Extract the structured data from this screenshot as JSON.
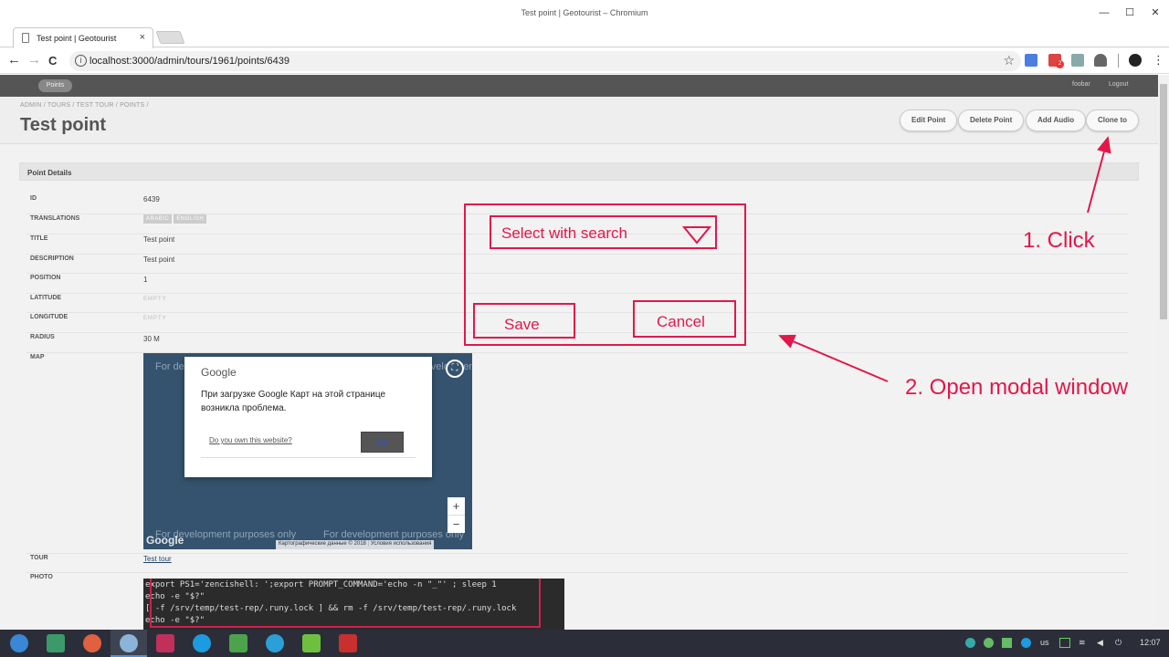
{
  "window": {
    "title": "Test point | Geotourist – Chromium",
    "minimize": "—",
    "maximize": "☐",
    "close": "✕"
  },
  "tabs": [
    {
      "label": "Test point | Geotourist",
      "close": "×"
    }
  ],
  "toolbar": {
    "back": "←",
    "forward": "→",
    "reload": "C",
    "url": "localhost:3000/admin/tours/1961/points/6439",
    "bookmark": "☆",
    "mail_badge": "2"
  },
  "appbar": {
    "nav_pill": "Points",
    "user": "foobar",
    "logout": "Logout"
  },
  "header": {
    "breadcrumbs": "ADMIN  /  TOURS  /  TEST TOUR  /  POINTS  /",
    "title": "Test point",
    "buttons": {
      "edit": "Edit Point",
      "delete": "Delete Point",
      "audio": "Add Audio",
      "clone": "Clone to"
    }
  },
  "panel": {
    "title": "Point Details",
    "rows": {
      "id": {
        "label": "ID",
        "value": "6439"
      },
      "translations": {
        "label": "TRANSLATIONS",
        "badges": [
          "ARABIC",
          "ENGLISH"
        ]
      },
      "title": {
        "label": "TITLE",
        "value": "Test point"
      },
      "description": {
        "label": "DESCRIPTION",
        "value": "Test point"
      },
      "position": {
        "label": "POSITION",
        "value": "1"
      },
      "latitude": {
        "label": "LATITUDE",
        "value": "EMPTY"
      },
      "longitude": {
        "label": "LONGITUDE",
        "value": "EMPTY"
      },
      "radius": {
        "label": "RADIUS",
        "value": "30 M"
      },
      "map": {
        "label": "MAP"
      },
      "tour": {
        "label": "TOUR",
        "value": "Test tour"
      },
      "photo": {
        "label": "PHOTO"
      }
    }
  },
  "map": {
    "watermark": "For development purposes only",
    "watermark_short": "For de",
    "dialog_logo": "Google",
    "dialog_message": "При загрузке Google Карт на этой странице возникла проблема.",
    "dialog_own": "Do you own this website?",
    "dialog_ok": "OK",
    "zoom_in": "+",
    "zoom_out": "−",
    "fullscreen": "⛶",
    "google": "Google",
    "attribution": "Картографические данные © 2018",
    "terms": "Условия использования"
  },
  "terminal": {
    "lines": [
      "export PS1='zencishell: ';export PROMPT_COMMAND='echo -n \"_\"' ; sleep 1",
      "echo -e \"$?\"",
      "[ -f /srv/temp/test-rep/.runy.lock ] && rm -f /srv/temp/test-rep/.runy.lock",
      "echo -e \"$?\""
    ]
  },
  "annotation": {
    "select_placeholder": "Select with search",
    "save": "Save",
    "cancel": "Cancel",
    "step1": "1. Click",
    "step2": "2. Open modal window",
    "color": "#e2174a"
  },
  "taskbar": {
    "layout": "us",
    "time": "12:07"
  }
}
